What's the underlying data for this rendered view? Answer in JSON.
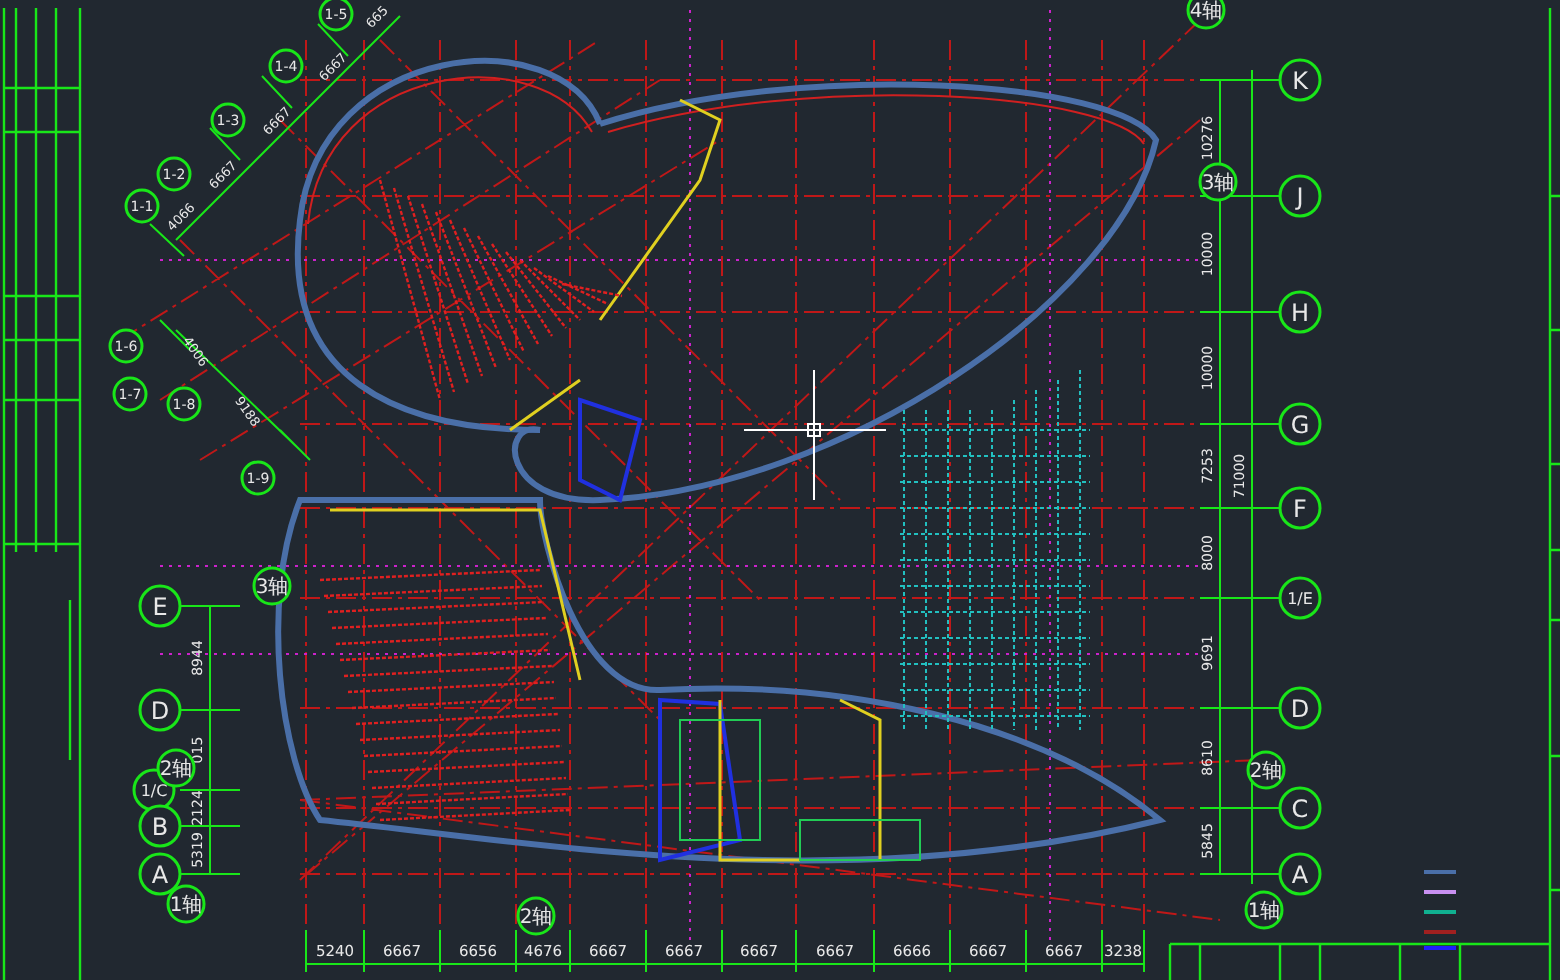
{
  "right_axes": [
    {
      "label": "K"
    },
    {
      "label": "J"
    },
    {
      "label": "H"
    },
    {
      "label": "G"
    },
    {
      "label": "F"
    },
    {
      "label": "1/E"
    },
    {
      "label": "D"
    },
    {
      "label": "C"
    },
    {
      "label": "A"
    }
  ],
  "right_dimensions": [
    "10276",
    "10000",
    "10000",
    "7253",
    "8000",
    "9691",
    "8610",
    "5845"
  ],
  "right_total": "71000",
  "left_axes": [
    {
      "label": "E"
    },
    {
      "label": "D"
    },
    {
      "label": "1/C"
    },
    {
      "label": "B"
    },
    {
      "label": "A"
    }
  ],
  "left_dimensions": [
    "8944",
    "015",
    "2124",
    "5319"
  ],
  "bottom_dimensions": [
    "5240",
    "6667",
    "6656",
    "4676",
    "6667",
    "6667",
    "6667",
    "6667",
    "6666",
    "6667",
    "6667",
    "3238"
  ],
  "diagonal_axes": [
    {
      "label": "1-5"
    },
    {
      "label": "1-4"
    },
    {
      "label": "1-3"
    },
    {
      "label": "1-2"
    },
    {
      "label": "1-1"
    },
    {
      "label": "1-6"
    },
    {
      "label": "1-7"
    },
    {
      "label": "1-8"
    },
    {
      "label": "1-9"
    }
  ],
  "diagonal_dimensions": [
    "665",
    "6667",
    "6667",
    "6667",
    "4066",
    "4006",
    "9188"
  ],
  "ring_axes": [
    {
      "label": "4轴"
    },
    {
      "label": "3轴"
    },
    {
      "label": "2轴"
    },
    {
      "label": "1轴"
    },
    {
      "label": "3轴"
    },
    {
      "label": "2轴"
    },
    {
      "label": "1轴"
    },
    {
      "label": "2轴"
    }
  ]
}
